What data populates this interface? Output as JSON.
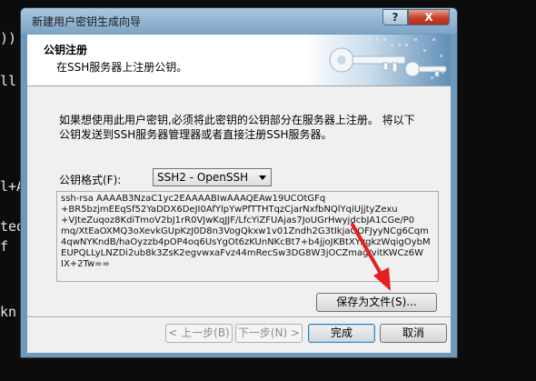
{
  "terminal": {
    "lines": [
      "))",
      "ll",
      "l+A",
      "ted",
      " f",
      "kn"
    ]
  },
  "window": {
    "title": "新建用户密钥生成向导",
    "help_label": "?",
    "close_label": "X"
  },
  "header": {
    "title": "公钥注册",
    "subtitle": "在SSH服务器上注册公钥。"
  },
  "description": "如果想使用此用户密钥,必须将此密钥的公钥部分在服务器上注册。 将以下公钥发送到SSH服务器管理器或者直接注册SSH服务器。",
  "format": {
    "label": "公钥格式(F):",
    "selected": "SSH2 - OpenSSH"
  },
  "public_key": "ssh-rsa AAAAB3NzaC1yc2EAAAABIwAAAQEAw19UCOtGFq\n+BR5bzjmEEqSf52YaDDX6DeJI0AfYlpYwPfTTHTqzCjarNxfbNQlYqiUjjtyZexu\n+VJteZuqoz8KdiTmoV2bJ1rR0VJwKqJJF/LfcYiZFUAjas7JoUGrHwyjdcbJA1CGe/P0\nmq/XtEaOXMQ3oXevkGUpKzJ0D8n3VogQkxw1v01Zndh2G3tIkjaGOFJyyNCg6Cqm\n4qwNYKndB/haOyzzb4pOP4oq6UsYgOt6zKUnNKcBt7+b4jjoJKBtXYzgkzWqigOybM\nEUPQLLyLNZDi2ub8k3ZsK2egvwxaFvz44mRecSw3DG8W3jOCZmag/vitKWCz6W\nIX+2Tw==",
  "buttons": {
    "save_to_file": "保存为文件(S)...",
    "back": "< 上一步(B)",
    "next": "下一步(N) >",
    "finish": "完成",
    "cancel": "取消"
  },
  "colors": {
    "title_bar": "#8fb3d1",
    "close_button": "#c5402a",
    "annotation_arrow": "#e5201d"
  }
}
